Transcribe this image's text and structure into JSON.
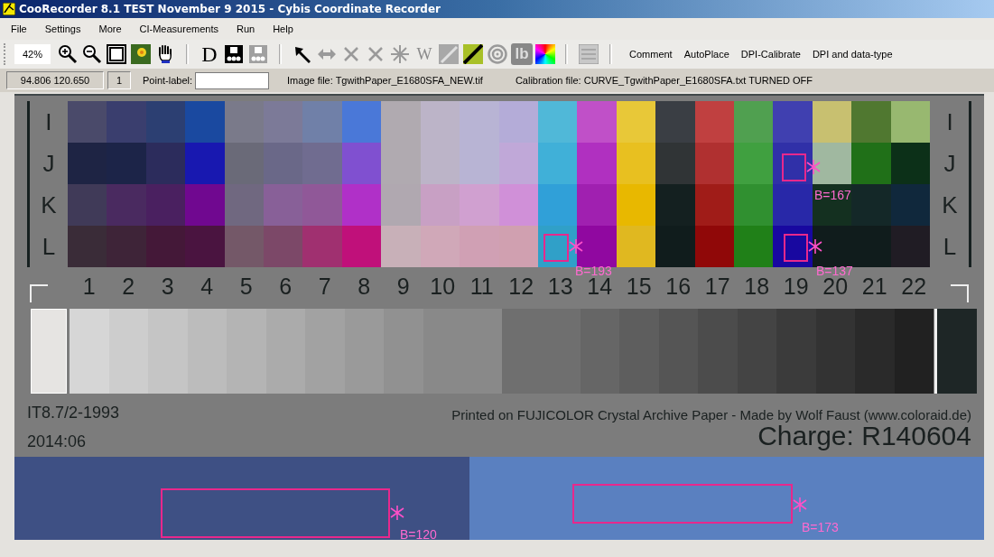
{
  "window": {
    "title": "CooRecorder 8.1 TEST November 9 2015 - Cybis Coordinate Recorder"
  },
  "menu": [
    "File",
    "Settings",
    "More",
    "CI-Measurements",
    "Run",
    "Help"
  ],
  "toolbar": {
    "zoom": "42%",
    "tools": [
      {
        "kind": "zoom-in",
        "disabled": false
      },
      {
        "kind": "zoom-out",
        "disabled": false
      },
      {
        "kind": "frame",
        "disabled": false
      },
      {
        "kind": "photo"
      },
      {
        "kind": "hand",
        "disabled": false
      },
      {
        "kind": "separator"
      },
      {
        "kind": "letter",
        "label": "D",
        "disabled": false
      },
      {
        "kind": "device",
        "disabled": false
      },
      {
        "kind": "device",
        "disabled": true
      },
      {
        "kind": "separator"
      },
      {
        "kind": "arrow",
        "disabled": false
      },
      {
        "kind": "double-arrow",
        "disabled": true
      },
      {
        "kind": "cross",
        "disabled": true
      },
      {
        "kind": "cross",
        "disabled": true
      },
      {
        "kind": "asterisk",
        "disabled": true
      },
      {
        "kind": "letter",
        "label": "W",
        "disabled": true
      },
      {
        "kind": "slash",
        "disabled": true
      },
      {
        "kind": "highlight-slash",
        "disabled": false
      },
      {
        "kind": "target",
        "disabled": true
      },
      {
        "kind": "badge",
        "label": "lb",
        "disabled": true
      },
      {
        "kind": "color-wheel",
        "disabled": false
      },
      {
        "kind": "separator"
      },
      {
        "kind": "notes",
        "disabled": true
      },
      {
        "kind": "separator"
      }
    ],
    "commands": [
      "Comment",
      "AutoPlace",
      "DPI-Calibrate",
      "DPI and data-type"
    ]
  },
  "status": {
    "coordinates": "94.806  120.650",
    "point_number": "1",
    "point_label": {
      "label": "Point-label:"
    },
    "image_file": "Image file: TgwithPaper_E1680SFA_NEW.tif",
    "calibration_file": "Calibration file: CURVE_TgwithPaper_E1680SFA.txt TURNED OFF"
  },
  "chart": {
    "row_labels_left": [
      "I",
      "J",
      "K",
      "L"
    ],
    "row_labels_right": [
      "I",
      "J",
      "K",
      "L"
    ],
    "column_numbers": [
      "1",
      "2",
      "3",
      "4",
      "5",
      "6",
      "7",
      "8",
      "9",
      "10",
      "11",
      "12",
      "13",
      "14",
      "15",
      "16",
      "17",
      "18",
      "19",
      "20",
      "21",
      "22"
    ],
    "standard": "IT8.7/2-1993",
    "date": "2014:06",
    "note": "Printed on FUJICOLOR Crystal Archive Paper  -  Made by Wolf Faust (www.coloraid.de)",
    "charge": "Charge: R140604"
  },
  "markers": [
    {
      "label": "B=193"
    },
    {
      "label": "B=167"
    },
    {
      "label": "B=137"
    },
    {
      "label": "B=120"
    },
    {
      "label": "B=173"
    }
  ]
}
